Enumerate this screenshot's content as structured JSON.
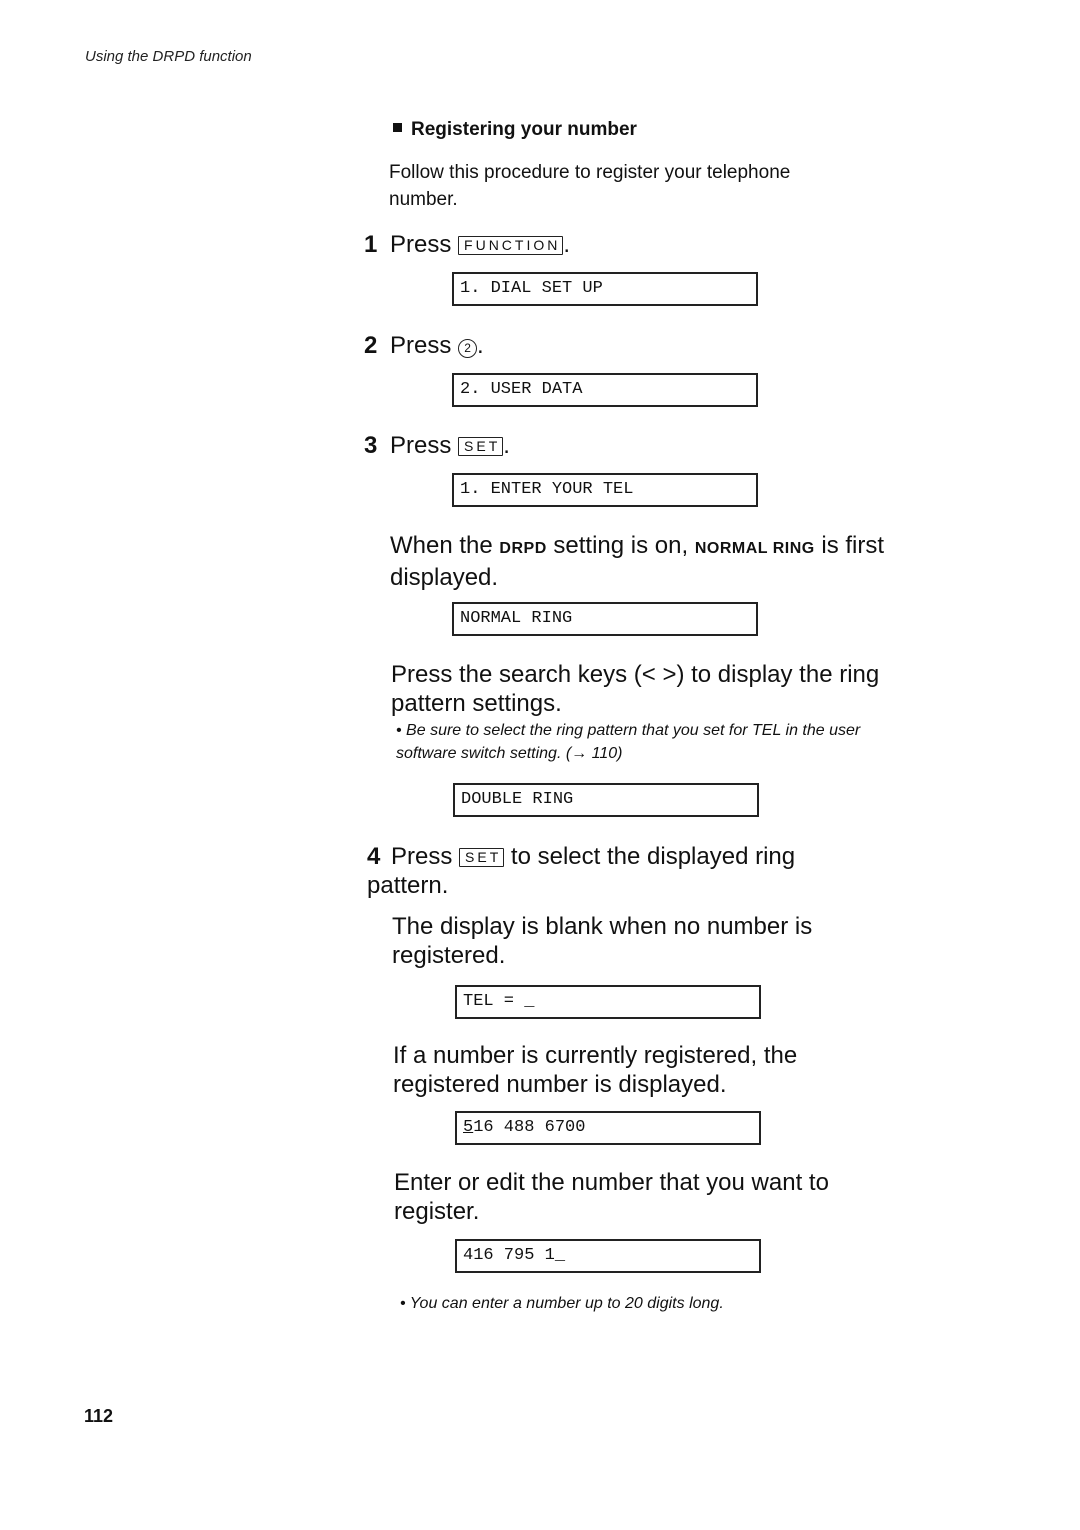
{
  "header": {
    "running_head": "Using the DRPD function"
  },
  "footer": {
    "page_number": "112"
  },
  "section": {
    "title": "Registering your number",
    "intro": "Follow this procedure to register your telephone number."
  },
  "steps": [
    {
      "num": "1",
      "press": "Press",
      "key": "FUNCTION",
      "suffix": ".",
      "display": "1. DIAL SET UP"
    },
    {
      "num": "2",
      "press": "Press",
      "key": "2",
      "suffix": ".",
      "display": "2. USER DATA"
    },
    {
      "num": "3",
      "press": "Press",
      "key": "SET",
      "suffix": ".",
      "display": "1. ENTER YOUR TEL"
    },
    {
      "num": "4",
      "press": "Press",
      "key": "SET",
      "suffix": " to select the displayed ring pattern."
    }
  ],
  "drpd_para": {
    "part1": "When the ",
    "term1": "DRPD",
    "part2": " setting is on, ",
    "term2": "NORMAL RING",
    "part3": " is first displayed.",
    "display": "NORMAL RING"
  },
  "search_para": {
    "text": "Press the search keys (< >) to display the ring pattern settings.",
    "note": "Be sure to select the ring pattern that you set for TEL in the user software switch setting. (→ 110)",
    "display": "DOUBLE RING"
  },
  "blank_para": {
    "text": "The display is blank when no number is registered.",
    "display_prefix": "TEL = ",
    "cursor": "_"
  },
  "registered_para": {
    "text": "If a number is currently registered, the registered number is displayed.",
    "display_cursor_char": "5",
    "display_rest": "16 488 6700"
  },
  "edit_para": {
    "text": "Enter or edit the number that you want to register.",
    "display_value": "416 795 1",
    "cursor": "_",
    "note": "You can enter a number up to 20 digits long."
  }
}
